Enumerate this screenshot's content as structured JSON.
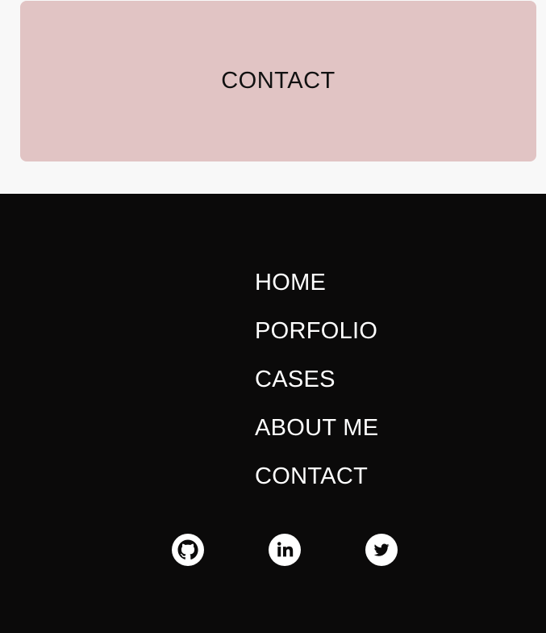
{
  "contact_card": {
    "label": "CONTACT",
    "color": "#e1c4c4"
  },
  "footer": {
    "background": "#0b0a0a",
    "nav": [
      {
        "label": "HOME"
      },
      {
        "label": "PORFOLIO"
      },
      {
        "label": "CASES"
      },
      {
        "label": "ABOUT ME"
      },
      {
        "label": "CONTACT"
      }
    ],
    "social": [
      {
        "icon": "github-icon"
      },
      {
        "icon": "linkedin-icon"
      },
      {
        "icon": "twitter-icon"
      }
    ]
  }
}
